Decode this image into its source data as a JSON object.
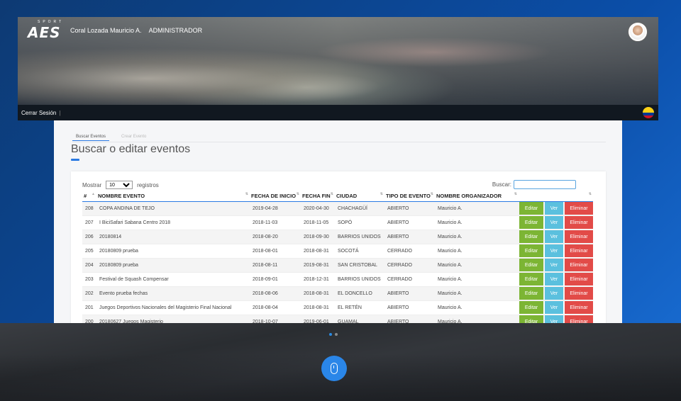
{
  "header": {
    "logo_text": "AES",
    "logo_sup": "SPORT",
    "user_name": "Coral Lozada Mauricio A.",
    "user_role": "ADMINISTRADOR"
  },
  "nav": {
    "logout": "Cerrar Sesión",
    "separator": "|"
  },
  "tabs": [
    {
      "label": "Buscar Eventos",
      "active": true
    },
    {
      "label": "Crear Evento",
      "active": false
    }
  ],
  "page_title": "Buscar o editar eventos",
  "table_controls": {
    "show_label": "Mostrar",
    "page_length": "10",
    "records_label": "registros",
    "search_label": "Buscar:",
    "search_value": ""
  },
  "columns": [
    "#",
    "NOMBRE EVENTO",
    "FECHA DE INICIO",
    "FECHA FIN",
    "CIUDAD",
    "TIPO DE EVENTO",
    "NOMBRE ORGANIZADOR",
    ""
  ],
  "actions": {
    "edit": "Editar",
    "view": "Ver",
    "delete": "Eliminar"
  },
  "rows": [
    [
      "208",
      "COPA ANDINA DE TEJO",
      "2019-04-28",
      "2020-04-30",
      "CHACHAGÜÍ",
      "ABIERTO",
      "Mauricio A."
    ],
    [
      "207",
      "I BiciSafari Sabana Centro 2018",
      "2018-11-03",
      "2018-11-05",
      "SOPÓ",
      "ABIERTO",
      "Mauricio A."
    ],
    [
      "206",
      "20180814",
      "2018-08-20",
      "2018-09-30",
      "BARRIOS UNIDOS",
      "ABIERTO",
      "Mauricio A."
    ],
    [
      "205",
      "20180809 prueba",
      "2018-08-01",
      "2018-08-31",
      "SOCOTÁ",
      "CERRADO",
      "Mauricio A."
    ],
    [
      "204",
      "20180809 prueba",
      "2018-08-11",
      "2019-08-31",
      "SAN CRISTOBAL",
      "CERRADO",
      "Mauricio A."
    ],
    [
      "203",
      "Festival de Squash Compensar",
      "2018-09-01",
      "2018-12-31",
      "BARRIOS UNIDOS",
      "CERRADO",
      "Mauricio A."
    ],
    [
      "202",
      "Evento prueba fechas",
      "2018-08-06",
      "2018-08-31",
      "EL DONCELLO",
      "ABIERTO",
      "Mauricio A."
    ],
    [
      "201",
      "Juegos Deportivos Nacionales del Magisterio Final Nacional",
      "2018-08-04",
      "2018-08-31",
      "EL RETÉN",
      "ABIERTO",
      "Mauricio A."
    ],
    [
      "200",
      "20180627 Juegos Magisterio",
      "2018-10-07",
      "2019-06-01",
      "GUAMAL",
      "ABIERTO",
      "Mauricio A."
    ]
  ],
  "colors": {
    "accent": "#2a7ae2",
    "edit": "#7cb534",
    "view": "#5bc0de",
    "delete": "#e24b48"
  }
}
